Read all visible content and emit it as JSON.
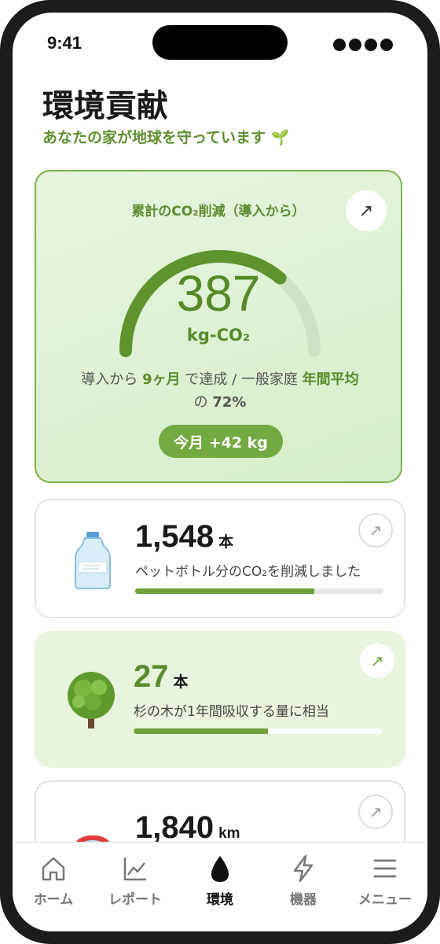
{
  "status_bar": {
    "time": "9:41"
  },
  "header": {
    "title": "環境貢献",
    "subtitle": "あなたの家が地球を守っています 🌱"
  },
  "hero": {
    "label": "累計のCO₂削減（導入から）",
    "value": "387",
    "unit": "kg-CO₂",
    "gauge_fill_fraction": 0.72,
    "desc_prefix": "導入から",
    "desc_months": "9ヶ月",
    "desc_mid": "で達成 / 一般家庭",
    "desc_ref": "年間平均",
    "desc_of": "の",
    "desc_percent": "72%",
    "monthly_badge": "今月 +42 kg",
    "arrow_icon": "arrow-up-right-icon"
  },
  "cards": [
    {
      "icon": "water-bottle-icon",
      "value": "1,548",
      "unit": "本",
      "desc": "ペットボトル分のCO₂を削減しました",
      "progress": 0.72
    },
    {
      "icon": "tree-icon",
      "value": "27",
      "unit": "本",
      "desc": "杉の木が1年間吸収する量に相当",
      "progress": 0.54
    },
    {
      "icon": "car-icon",
      "value": "1,840",
      "unit": "km"
    }
  ],
  "tabbar": {
    "items": [
      {
        "label": "ホーム",
        "icon": "home-icon"
      },
      {
        "label": "レポート",
        "icon": "chart-icon"
      },
      {
        "label": "環境",
        "icon": "drop-icon",
        "active": true
      },
      {
        "label": "機器",
        "icon": "bolt-icon"
      },
      {
        "label": "メニュー",
        "icon": "menu-icon"
      }
    ]
  },
  "colors": {
    "accent": "#5d8b2e",
    "accent_light": "#e8f4dd",
    "bar": "#6ea13a"
  }
}
